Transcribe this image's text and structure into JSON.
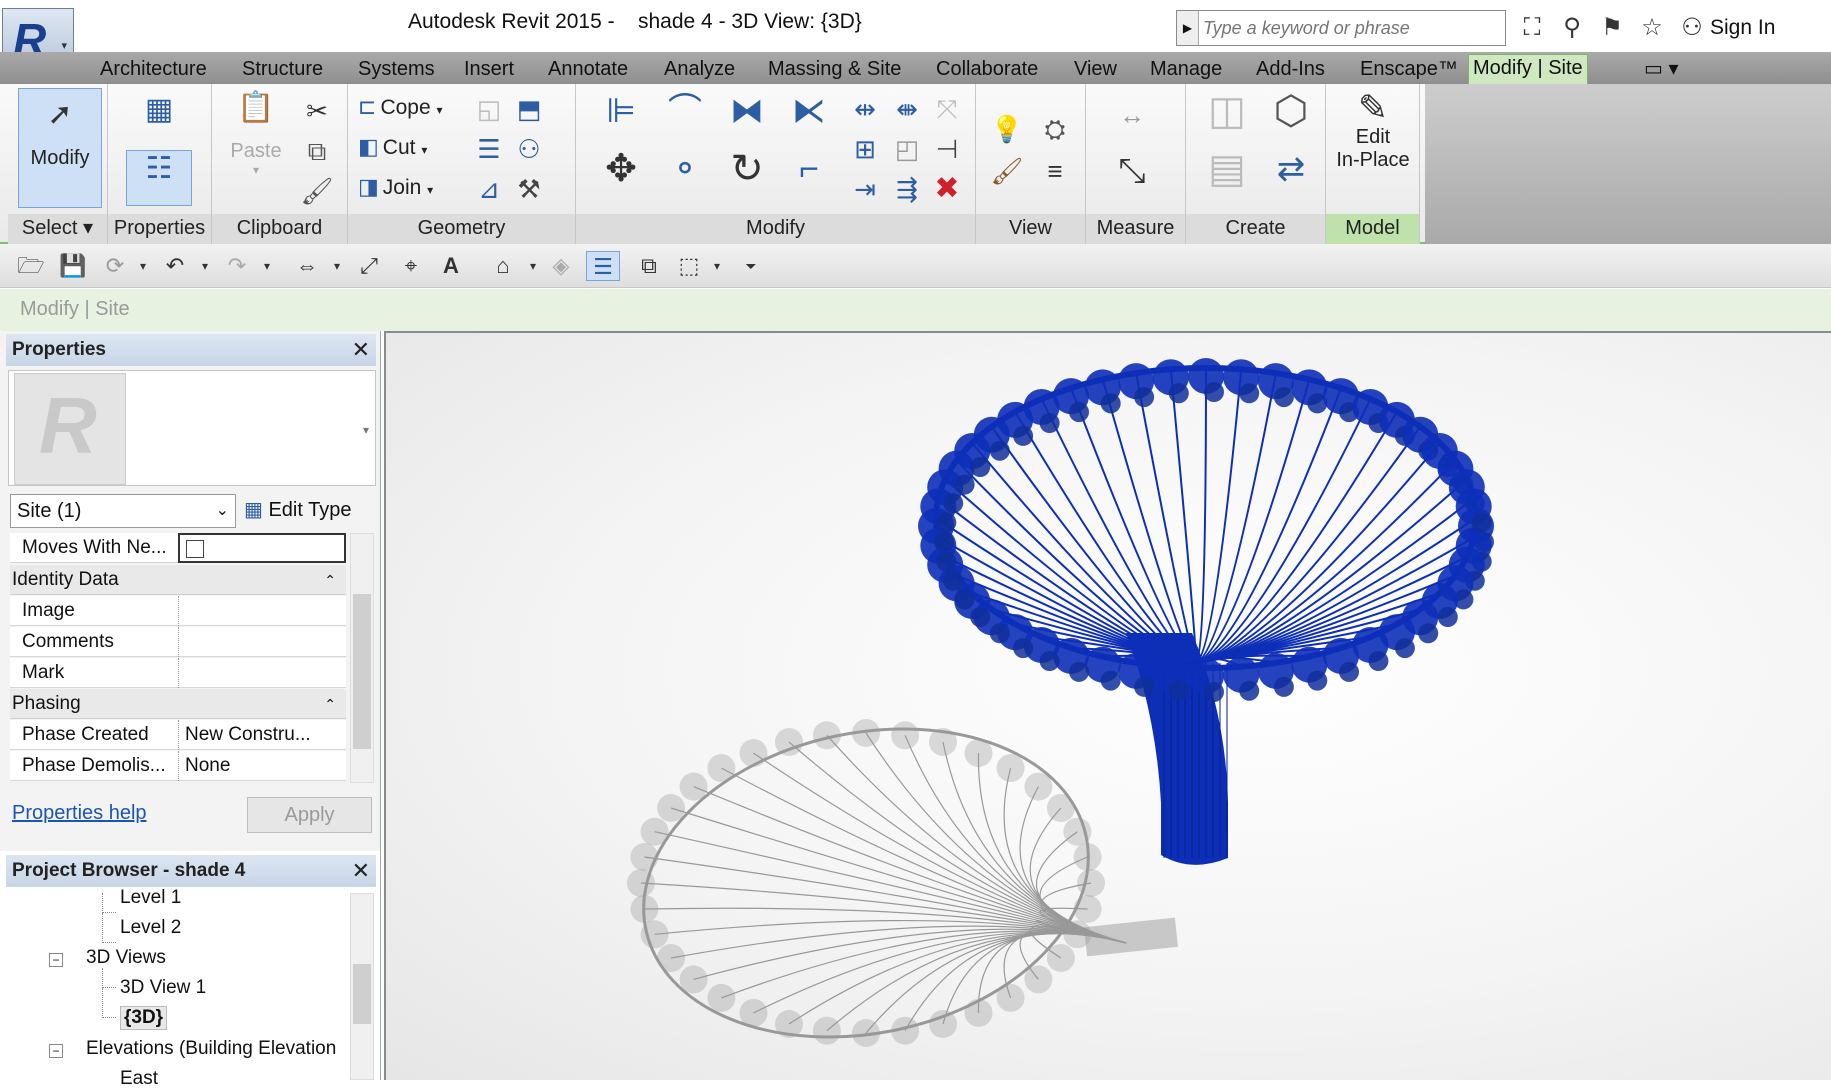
{
  "title": {
    "app": "Autodesk Revit 2015 -",
    "document": "shade 4 - 3D View: {3D}"
  },
  "search": {
    "placeholder": "Type a keyword or phrase"
  },
  "account": {
    "sign_in": "Sign In"
  },
  "tabs": [
    "Architecture",
    "Structure",
    "Systems",
    "Insert",
    "Annotate",
    "Analyze",
    "Massing & Site",
    "Collaborate",
    "View",
    "Manage",
    "Add-Ins",
    "Enscape™",
    "Modify | Site"
  ],
  "ribbon": {
    "select": {
      "modify": "Modify",
      "label": "Select"
    },
    "properties": {
      "label": "Properties"
    },
    "clipboard": {
      "paste": "Paste",
      "label": "Clipboard"
    },
    "geometry": {
      "cope": "Cope",
      "cut": "Cut",
      "join": "Join",
      "label": "Geometry"
    },
    "modify": {
      "label": "Modify"
    },
    "view": {
      "label": "View"
    },
    "measure": {
      "label": "Measure"
    },
    "create": {
      "label": "Create"
    },
    "model": {
      "edit_line1": "Edit",
      "edit_line2": "In-Place",
      "label": "Model"
    }
  },
  "options_bar": {
    "context": "Modify | Site"
  },
  "properties": {
    "title": "Properties",
    "type_selector": "Site (1)",
    "edit_type": "Edit Type",
    "rows": {
      "moves_with": "Moves With Ne...",
      "identity_group": "Identity Data",
      "image": "Image",
      "comments": "Comments",
      "mark": "Mark",
      "phasing_group": "Phasing",
      "phase_created": "Phase Created",
      "phase_created_value": "New Constru...",
      "phase_demolished": "Phase Demolis...",
      "phase_demolished_value": "None"
    },
    "help_link": "Properties help",
    "apply": "Apply"
  },
  "project_browser": {
    "title": "Project Browser - shade 4",
    "items": {
      "level1": "Level 1",
      "level2": "Level 2",
      "views3d": "3D Views",
      "view3d1": "3D View 1",
      "view3d": "{3D}",
      "elevations": "Elevations (Building Elevation",
      "east": "East"
    }
  },
  "colors": {
    "accent": "#1f3fbf",
    "ribbon_active": "#cfe8c2",
    "model_blue": "#0d2fb8",
    "shadow_gray": "#8f8f8f"
  }
}
